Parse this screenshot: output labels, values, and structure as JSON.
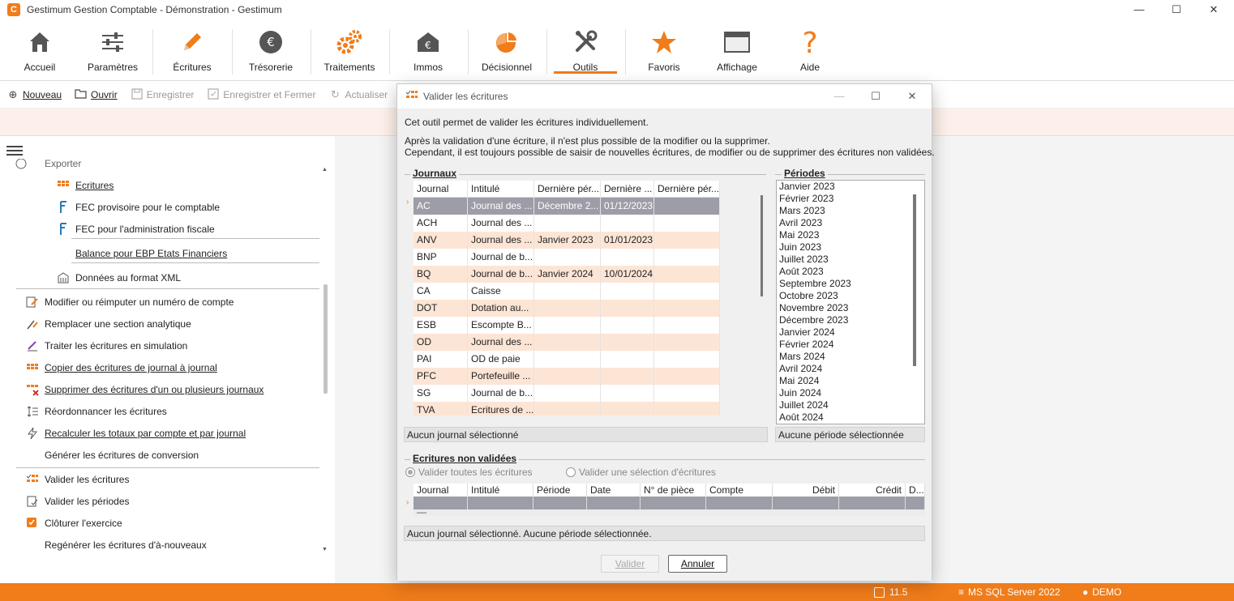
{
  "window": {
    "title": "Gestimum Gestion Comptable - Démonstration - Gestimum",
    "logo_letter": "C",
    "minimize": "—",
    "maximize": "☐",
    "close": "✕"
  },
  "ribbon": {
    "tabs": [
      {
        "label": "Accueil",
        "icon": "home-icon"
      },
      {
        "label": "Paramètres",
        "icon": "sliders-icon"
      },
      {
        "label": "Écritures",
        "icon": "pencil-icon"
      },
      {
        "label": "Trésorerie",
        "icon": "euro-coin-icon"
      },
      {
        "label": "Traitements",
        "icon": "gears-icon"
      },
      {
        "label": "Immos",
        "icon": "building-euro-icon"
      },
      {
        "label": "Décisionnel",
        "icon": "pie-chart-icon"
      },
      {
        "label": "Outils",
        "icon": "tools-icon",
        "active": true
      },
      {
        "label": "Favoris",
        "icon": "star-icon"
      },
      {
        "label": "Affichage",
        "icon": "window-icon"
      },
      {
        "label": "Aide",
        "icon": "question-icon"
      }
    ],
    "accent_color": "#f07c1a",
    "euro_symbol": "€",
    "question_symbol": "?"
  },
  "toolbar": {
    "nouveau": "Nouveau",
    "ouvrir": "Ouvrir",
    "enregistrer": "Enregistrer",
    "enregistrer_fermer": "Enregistrer et Fermer",
    "actualiser": "Actualiser"
  },
  "left_panel": {
    "partial_header": "Exporter",
    "export_items": [
      "Ecritures",
      "FEC provisoire pour le comptable",
      "FEC pour l'administration fiscale",
      "Balance pour EBP Etats Financiers",
      "Données au format XML"
    ],
    "tool_items": [
      "Modifier ou réimputer un numéro de compte",
      "Remplacer une section analytique",
      "Traiter les écritures en simulation",
      "Copier des écritures de journal à journal",
      "Supprimer des écritures d'un ou plusieurs journaux",
      "Réordonnancer les écritures",
      "Recalculer les totaux par compte et par journal",
      "Générer les écritures de conversion"
    ],
    "validation_items": [
      "Valider les écritures",
      "Valider les périodes",
      "Clôturer l'exercice",
      "Regénérer les écritures d'à-nouveaux"
    ]
  },
  "dialog": {
    "title": "Valider les écritures",
    "intro1": "Cet outil permet de valider les écritures individuellement.",
    "intro2": "Après la validation d'une écriture, il n'est plus possible de la modifier ou la supprimer.",
    "intro3": "Cependant, il est toujours possible de saisir de nouvelles écritures, de modifier ou de supprimer des écritures non validées.",
    "journaux_label": "Journaux",
    "periodes_label": "Périodes",
    "journaux_columns": [
      "Journal",
      "Intitulé",
      "Dernière pér...",
      "Dernière ...",
      "Dernière pér..."
    ],
    "journaux_rows": [
      [
        "AC",
        "Journal des ...",
        "Décembre 2...",
        "01/12/2023",
        ""
      ],
      [
        "ACH",
        "Journal des ...",
        "",
        "",
        ""
      ],
      [
        "ANV",
        "Journal des ...",
        "Janvier 2023",
        "01/01/2023",
        ""
      ],
      [
        "BNP",
        "Journal de b...",
        "",
        "",
        ""
      ],
      [
        "BQ",
        "Journal de b...",
        "Janvier 2024",
        "10/01/2024",
        ""
      ],
      [
        "CA",
        "Caisse",
        "",
        "",
        ""
      ],
      [
        "DOT",
        "Dotation au...",
        "",
        "",
        ""
      ],
      [
        "ESB",
        "Escompte B...",
        "",
        "",
        ""
      ],
      [
        "OD",
        "Journal des ...",
        "",
        "",
        ""
      ],
      [
        "PAI",
        "OD de paie",
        "",
        "",
        ""
      ],
      [
        "PFC",
        "Portefeuille ...",
        "",
        "",
        ""
      ],
      [
        "SG",
        "Journal de b...",
        "",
        "",
        ""
      ],
      [
        "TVA",
        "Ecritures de ...",
        "",
        "",
        ""
      ]
    ],
    "row_marker": "›",
    "periodes": [
      "Janvier 2023",
      "Février 2023",
      "Mars 2023",
      "Avril 2023",
      "Mai 2023",
      "Juin 2023",
      "Juillet 2023",
      "Août 2023",
      "Septembre 2023",
      "Octobre 2023",
      "Novembre 2023",
      "Décembre 2023",
      "Janvier 2024",
      "Février 2024",
      "Mars 2024",
      "Avril 2024",
      "Mai 2024",
      "Juin 2024",
      "Juillet 2024",
      "Août 2024"
    ],
    "journal_status": "Aucun journal sélectionné",
    "periode_status": "Aucune période sélectionnée",
    "ecritures_label": "Ecritures non validées",
    "radio_all": "Valider toutes les écritures",
    "radio_selection": "Valider une sélection d'écritures",
    "ecritures_columns": [
      "Journal",
      "Intitulé",
      "Période",
      "Date",
      "N° de pièce",
      "Compte",
      "Débit",
      "Crédit",
      "D..."
    ],
    "ecritures_new_row_marker": "—",
    "footer_status": "Aucun journal sélectionné. Aucune période sélectionnée.",
    "btn_valider": "Valider",
    "btn_annuler": "Annuler"
  },
  "statusbar": {
    "version": "11.5",
    "server": "MS SQL Server 2022",
    "user": "DEMO"
  }
}
